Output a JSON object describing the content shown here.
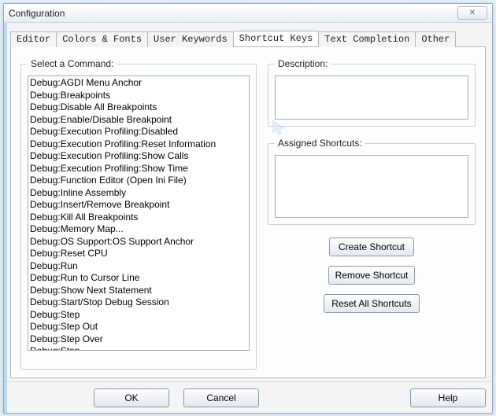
{
  "window": {
    "title": "Configuration",
    "close_glyph": "✕"
  },
  "tabs": [
    {
      "label": "Editor"
    },
    {
      "label": "Colors & Fonts"
    },
    {
      "label": "User Keywords"
    },
    {
      "label": "Shortcut Keys",
      "active": true
    },
    {
      "label": "Text Completion"
    },
    {
      "label": "Other"
    }
  ],
  "groups": {
    "select_command": "Select a Command:",
    "description": "Description:",
    "assigned": "Assigned Shortcuts:"
  },
  "commands": [
    "Debug:AGDI Menu Anchor",
    "Debug:Breakpoints",
    "Debug:Disable All Breakpoints",
    "Debug:Enable/Disable Breakpoint",
    "Debug:Execution Profiling:Disabled",
    "Debug:Execution Profiling:Reset Information",
    "Debug:Execution Profiling:Show Calls",
    "Debug:Execution Profiling:Show Time",
    "Debug:Function Editor (Open Ini File)",
    "Debug:Inline Assembly",
    "Debug:Insert/Remove Breakpoint",
    "Debug:Kill All Breakpoints",
    "Debug:Memory Map...",
    "Debug:OS Support:OS Support Anchor",
    "Debug:Reset CPU",
    "Debug:Run",
    "Debug:Run to Cursor Line",
    "Debug:Show Next Statement",
    "Debug:Start/Stop Debug Session",
    "Debug:Step",
    "Debug:Step Out",
    "Debug:Step Over",
    "Debug:Stop"
  ],
  "buttons": {
    "create": "Create Shortcut",
    "remove": "Remove Shortcut",
    "reset": "Reset All Shortcuts",
    "ok": "OK",
    "cancel": "Cancel",
    "help": "Help"
  }
}
